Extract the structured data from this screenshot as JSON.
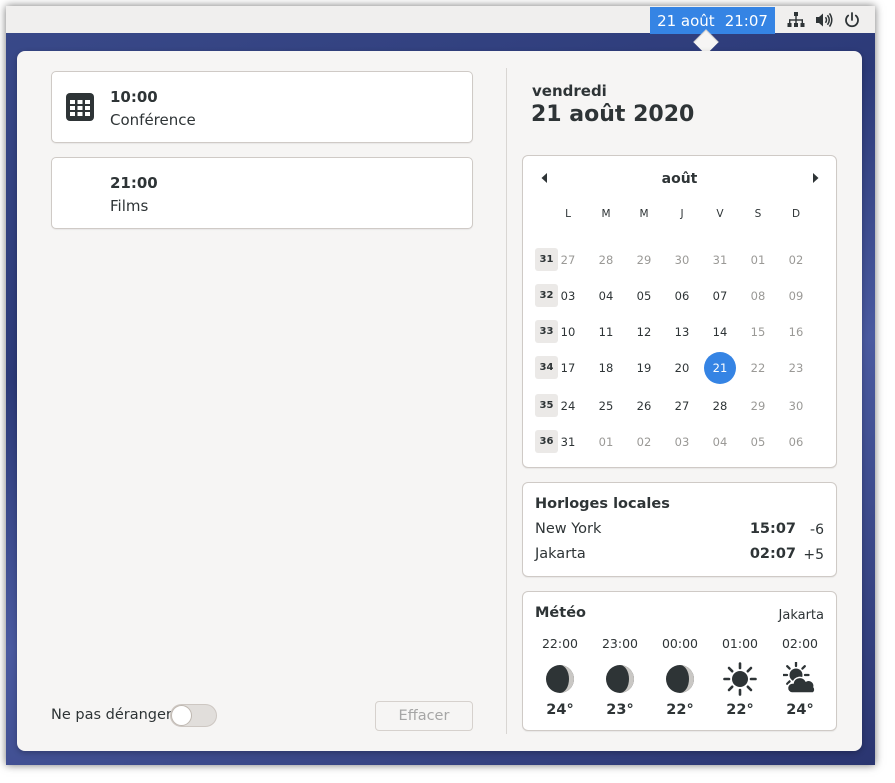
{
  "topbar": {
    "clock_date": "21 août",
    "clock_time": "21:07",
    "icons": [
      "network-icon",
      "volume-icon",
      "power-icon"
    ]
  },
  "events": [
    {
      "time": "10:00",
      "title": "Conférence",
      "icon": "calendar-icon"
    },
    {
      "time": "21:00",
      "title": "Films"
    }
  ],
  "dnd_label": "Ne pas déranger",
  "dnd_enabled": false,
  "clear_label": "Effacer",
  "date_header": {
    "weekday": "vendredi",
    "full": "21 août 2020"
  },
  "calendar": {
    "month": "août",
    "weekdays": [
      "L",
      "M",
      "M",
      "J",
      "V",
      "S",
      "D"
    ],
    "weeks": [
      {
        "num": "31",
        "days": [
          {
            "d": "27",
            "other": true
          },
          {
            "d": "28",
            "other": true
          },
          {
            "d": "29",
            "other": true
          },
          {
            "d": "30",
            "other": true
          },
          {
            "d": "31",
            "other": true
          },
          {
            "d": "01",
            "other": true
          },
          {
            "d": "02",
            "other": true
          }
        ]
      },
      {
        "num": "32",
        "days": [
          {
            "d": "03"
          },
          {
            "d": "04"
          },
          {
            "d": "05"
          },
          {
            "d": "06"
          },
          {
            "d": "07"
          },
          {
            "d": "08",
            "other": true
          },
          {
            "d": "09",
            "other": true
          }
        ]
      },
      {
        "num": "33",
        "days": [
          {
            "d": "10"
          },
          {
            "d": "11"
          },
          {
            "d": "12"
          },
          {
            "d": "13"
          },
          {
            "d": "14"
          },
          {
            "d": "15",
            "other": true
          },
          {
            "d": "16",
            "other": true
          }
        ]
      },
      {
        "num": "34",
        "days": [
          {
            "d": "17"
          },
          {
            "d": "18"
          },
          {
            "d": "19"
          },
          {
            "d": "20"
          },
          {
            "d": "21",
            "today": true
          },
          {
            "d": "22",
            "other": true
          },
          {
            "d": "23",
            "other": true
          }
        ]
      },
      {
        "num": "35",
        "days": [
          {
            "d": "24"
          },
          {
            "d": "25"
          },
          {
            "d": "26"
          },
          {
            "d": "27"
          },
          {
            "d": "28"
          },
          {
            "d": "29",
            "other": true
          },
          {
            "d": "30",
            "other": true
          }
        ]
      },
      {
        "num": "36",
        "days": [
          {
            "d": "31"
          },
          {
            "d": "01",
            "other": true
          },
          {
            "d": "02",
            "other": true
          },
          {
            "d": "03",
            "other": true
          },
          {
            "d": "04",
            "other": true
          },
          {
            "d": "05",
            "other": true
          },
          {
            "d": "06",
            "other": true
          }
        ]
      }
    ]
  },
  "world_clocks": {
    "title": "Horloges locales",
    "items": [
      {
        "city": "New York",
        "time": "15:07",
        "offset": "-6"
      },
      {
        "city": "Jakarta",
        "time": "02:07",
        "offset": "+5"
      }
    ]
  },
  "weather": {
    "title": "Météo",
    "location": "Jakarta",
    "forecast": [
      {
        "hour": "22:00",
        "icon": "moon-icon",
        "temp": "24°"
      },
      {
        "hour": "23:00",
        "icon": "moon-icon",
        "temp": "23°"
      },
      {
        "hour": "00:00",
        "icon": "moon-icon",
        "temp": "22°"
      },
      {
        "hour": "01:00",
        "icon": "sun-icon",
        "temp": "22°"
      },
      {
        "hour": "02:00",
        "icon": "partly-cloudy-icon",
        "temp": "24°"
      }
    ]
  },
  "colors": {
    "accent": "#3584e4",
    "panel": "#f6f5f4",
    "text": "#2e3436",
    "muted": "#9a9996"
  }
}
